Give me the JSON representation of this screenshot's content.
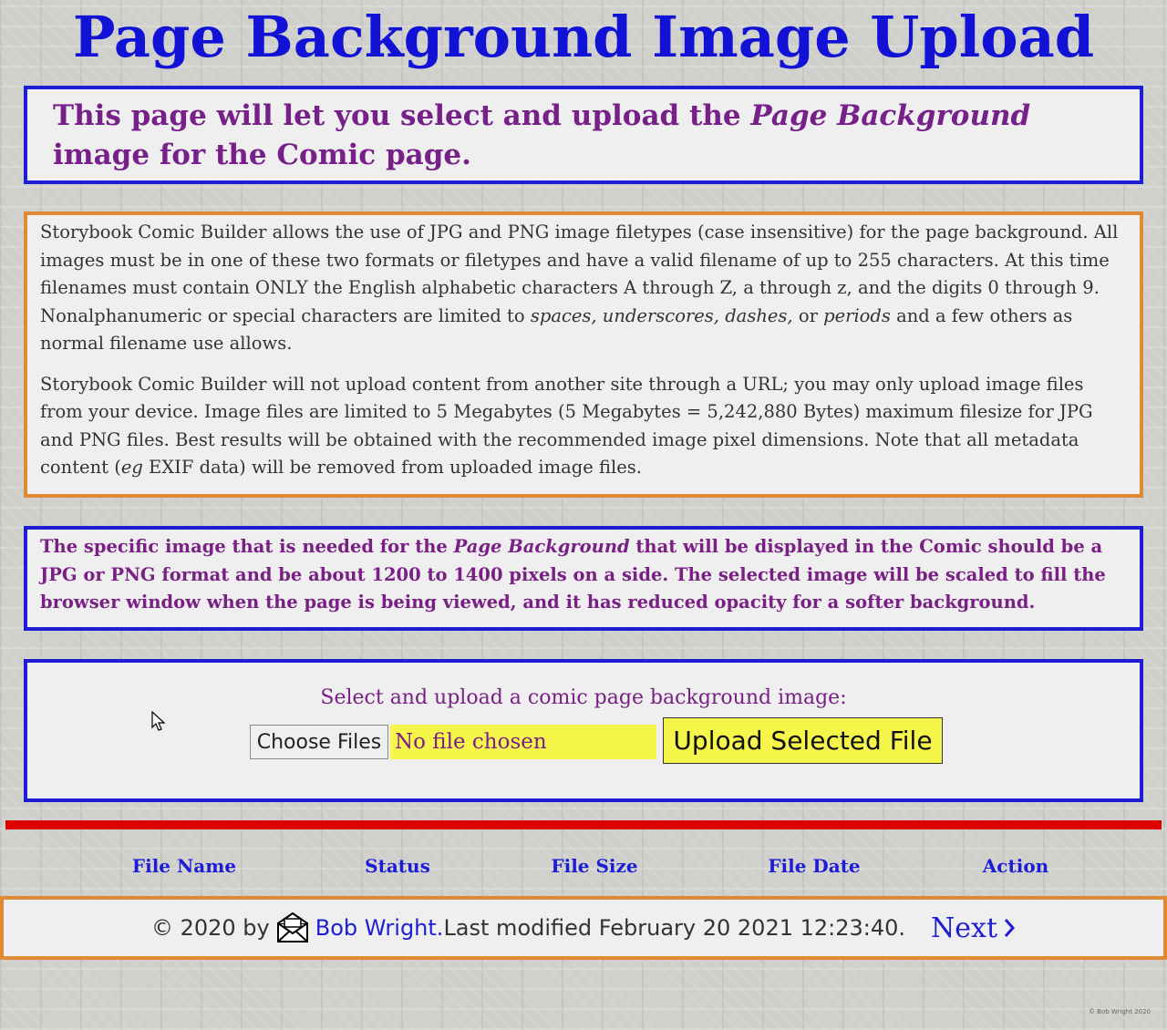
{
  "page": {
    "title": "Page Background Image Upload"
  },
  "intro": {
    "text_before": "This page will let you select and upload the ",
    "text_em": "Page Background",
    "text_after": " image for the Comic page."
  },
  "info": {
    "p1": {
      "t1": "Storybook Comic Builder allows the use of JPG and PNG image filetypes (case insensitive) for the page background. All images must be in one of these two formats or filetypes and have a valid filename of up to 255 characters. At this time filenames must contain ONLY the English alphabetic characters A through Z, a through z, and the digits 0 through 9. Nonalphanumeric or special characters are limited to ",
      "em1": "spaces, underscores, dashes,",
      "t2": " or ",
      "em2": "periods",
      "t3": " and a few others as normal filename use allows."
    },
    "p2": {
      "t1": "Storybook Comic Builder will not upload content from another site through a URL; you may only upload image files from your device. Image files are limited to 5 Megabytes (5 Megabytes = 5,242,880 Bytes) maximum filesize for JPG and PNG files. Best results will be obtained with the recommended image pixel dimensions. Note that all metadata content (",
      "em1": "eg",
      "t2": " EXIF data) will be removed from uploaded image files."
    }
  },
  "spec": {
    "t1": "The specific image that is needed for the ",
    "em1": "Page Background",
    "t2": " that will be displayed in the Comic should be a JPG or PNG format and be about 1200 to 1400 pixels on a side. The selected image will be scaled to fill the browser window when the page is being viewed, and it has reduced opacity for a softer background."
  },
  "upload": {
    "label": "Select and upload a comic page background image:",
    "choose_label": "Choose Files",
    "no_file_text": "No file chosen",
    "upload_label": "Upload Selected File"
  },
  "table": {
    "headers": [
      "File Name",
      "Status",
      "File Size",
      "File Date",
      "Action"
    ]
  },
  "footer": {
    "copyright": "© 2020 by",
    "author": "Bob Wright.",
    "modified": " Last modified February 20 2021 12:23:40.",
    "next_label": "Next",
    "next_icon": "chevron-right-icon",
    "mail_icon": "envelope-icon"
  },
  "watermark": "© Bob Wright 2020",
  "colors": {
    "title_blue": "#1212d6",
    "purple": "#78208a",
    "orange_border": "#e08a35",
    "red_rule": "#dd0000",
    "yellow": "#f6f64a"
  }
}
